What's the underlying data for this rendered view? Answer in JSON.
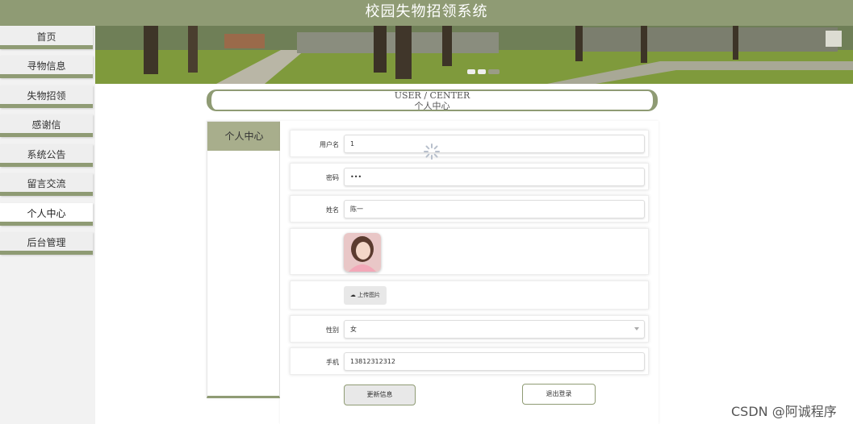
{
  "header": {
    "title": "校园失物招领系统"
  },
  "sidebar": {
    "items": [
      {
        "label": "首页"
      },
      {
        "label": "寻物信息"
      },
      {
        "label": "失物招领"
      },
      {
        "label": "感谢信"
      },
      {
        "label": "系统公告"
      },
      {
        "label": "留言交流"
      },
      {
        "label": "个人中心"
      },
      {
        "label": "后台管理"
      }
    ]
  },
  "section": {
    "title_en": "USER / CENTER",
    "title_cn": "个人中心"
  },
  "left_panel": {
    "tab_label": "个人中心"
  },
  "form": {
    "username": {
      "label": "用户名",
      "value": "1"
    },
    "password": {
      "label": "密码",
      "value": "•••"
    },
    "name": {
      "label": "姓名",
      "value": "陈一"
    },
    "upload_label": "上传图片",
    "gender": {
      "label": "性别",
      "value": "女"
    },
    "phone": {
      "label": "手机",
      "value": "13812312312"
    },
    "update_label": "更新信息",
    "logout_label": "退出登录"
  },
  "watermark": "CSDN @阿诚程序",
  "colors": {
    "accent": "#8f9b74",
    "tab_active": "#a8ae8c"
  },
  "icons": {
    "upload": "cloud-upload-icon",
    "loading": "loading-spinner-icon",
    "select": "chevron-down-icon"
  }
}
